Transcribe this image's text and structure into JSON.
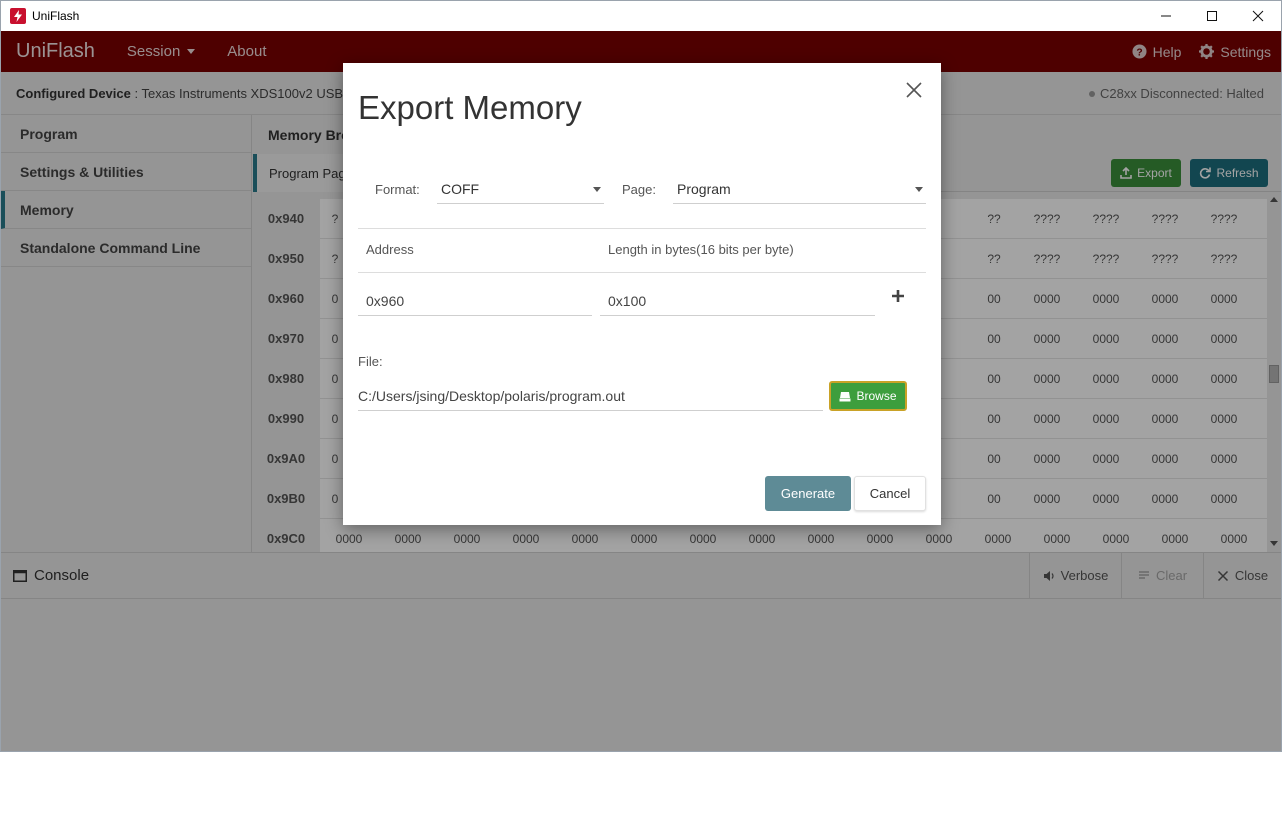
{
  "window": {
    "title": "UniFlash"
  },
  "header": {
    "brand": "UniFlash",
    "menu": [
      {
        "label": "Session"
      },
      {
        "label": "About"
      }
    ],
    "help_label": "Help",
    "settings_label": "Settings"
  },
  "device": {
    "label_prefix": "Configured Device",
    "label_value": " : Texas Instruments XDS100v2 USB ",
    "status": "C28xx Disconnected: Halted"
  },
  "sidebar": {
    "items": [
      {
        "label": "Program",
        "active": false
      },
      {
        "label": "Settings & Utilities",
        "active": false
      },
      {
        "label": "Memory",
        "active": true
      },
      {
        "label": "Standalone Command Line",
        "active": false
      }
    ]
  },
  "memory": {
    "title": "Memory Bro",
    "tab_label": "Program Pag",
    "export_label": "Export",
    "refresh_label": "Refresh",
    "rows": [
      {
        "addr": "0x940",
        "left": "?",
        "cells": [
          "??",
          "????",
          "????",
          "????",
          "????",
          "????",
          "????"
        ]
      },
      {
        "addr": "0x950",
        "left": "?",
        "cells": [
          "??",
          "????",
          "????",
          "????",
          "????",
          "????",
          "????"
        ]
      },
      {
        "addr": "0x960",
        "left": "0",
        "cells": [
          "00",
          "0000",
          "0000",
          "0000",
          "0000",
          "0000",
          "0000"
        ]
      },
      {
        "addr": "0x970",
        "left": "0",
        "cells": [
          "00",
          "0000",
          "0000",
          "0000",
          "0000",
          "0000",
          "0000"
        ]
      },
      {
        "addr": "0x980",
        "left": "0",
        "cells": [
          "00",
          "0000",
          "0000",
          "0000",
          "0000",
          "0000",
          "0000"
        ]
      },
      {
        "addr": "0x990",
        "left": "0",
        "cells": [
          "00",
          "0000",
          "0000",
          "0000",
          "0000",
          "0000",
          "0000"
        ]
      },
      {
        "addr": "0x9A0",
        "left": "0",
        "cells": [
          "00",
          "0000",
          "0000",
          "0000",
          "0000",
          "0000",
          "0000"
        ]
      },
      {
        "addr": "0x9B0",
        "left": "0",
        "cells": [
          "00",
          "0000",
          "0000",
          "0000",
          "0000",
          "0000",
          "0000"
        ]
      }
    ],
    "last_row": {
      "addr": "0x9C0",
      "cells": [
        "0000",
        "0000",
        "0000",
        "0000",
        "0000",
        "0000",
        "0000",
        "0000",
        "0000",
        "0000",
        "0000",
        "0000",
        "0000",
        "0000",
        "0000",
        "0000"
      ]
    }
  },
  "console": {
    "title": "Console",
    "verbose_label": "Verbose",
    "clear_label": "Clear",
    "close_label": "Close"
  },
  "dialog": {
    "title": "Export Memory",
    "format_label": "Format:",
    "format_value": "COFF",
    "page_label": "Page:",
    "page_value": "Program",
    "address_header": "Address",
    "length_header": "Length in bytes(16 bits per byte)",
    "address_value": "0x960",
    "length_value": "0x100",
    "file_label": "File:",
    "file_value": "C:/Users/jsing/Desktop/polaris/program.out",
    "browse_label": "Browse",
    "generate_label": "Generate",
    "cancel_label": "Cancel"
  },
  "colors": {
    "header_bg": "#7a0000",
    "accent": "#2a7a8c",
    "browse_green": "#3d9e3d",
    "generate": "#5e8b96"
  }
}
